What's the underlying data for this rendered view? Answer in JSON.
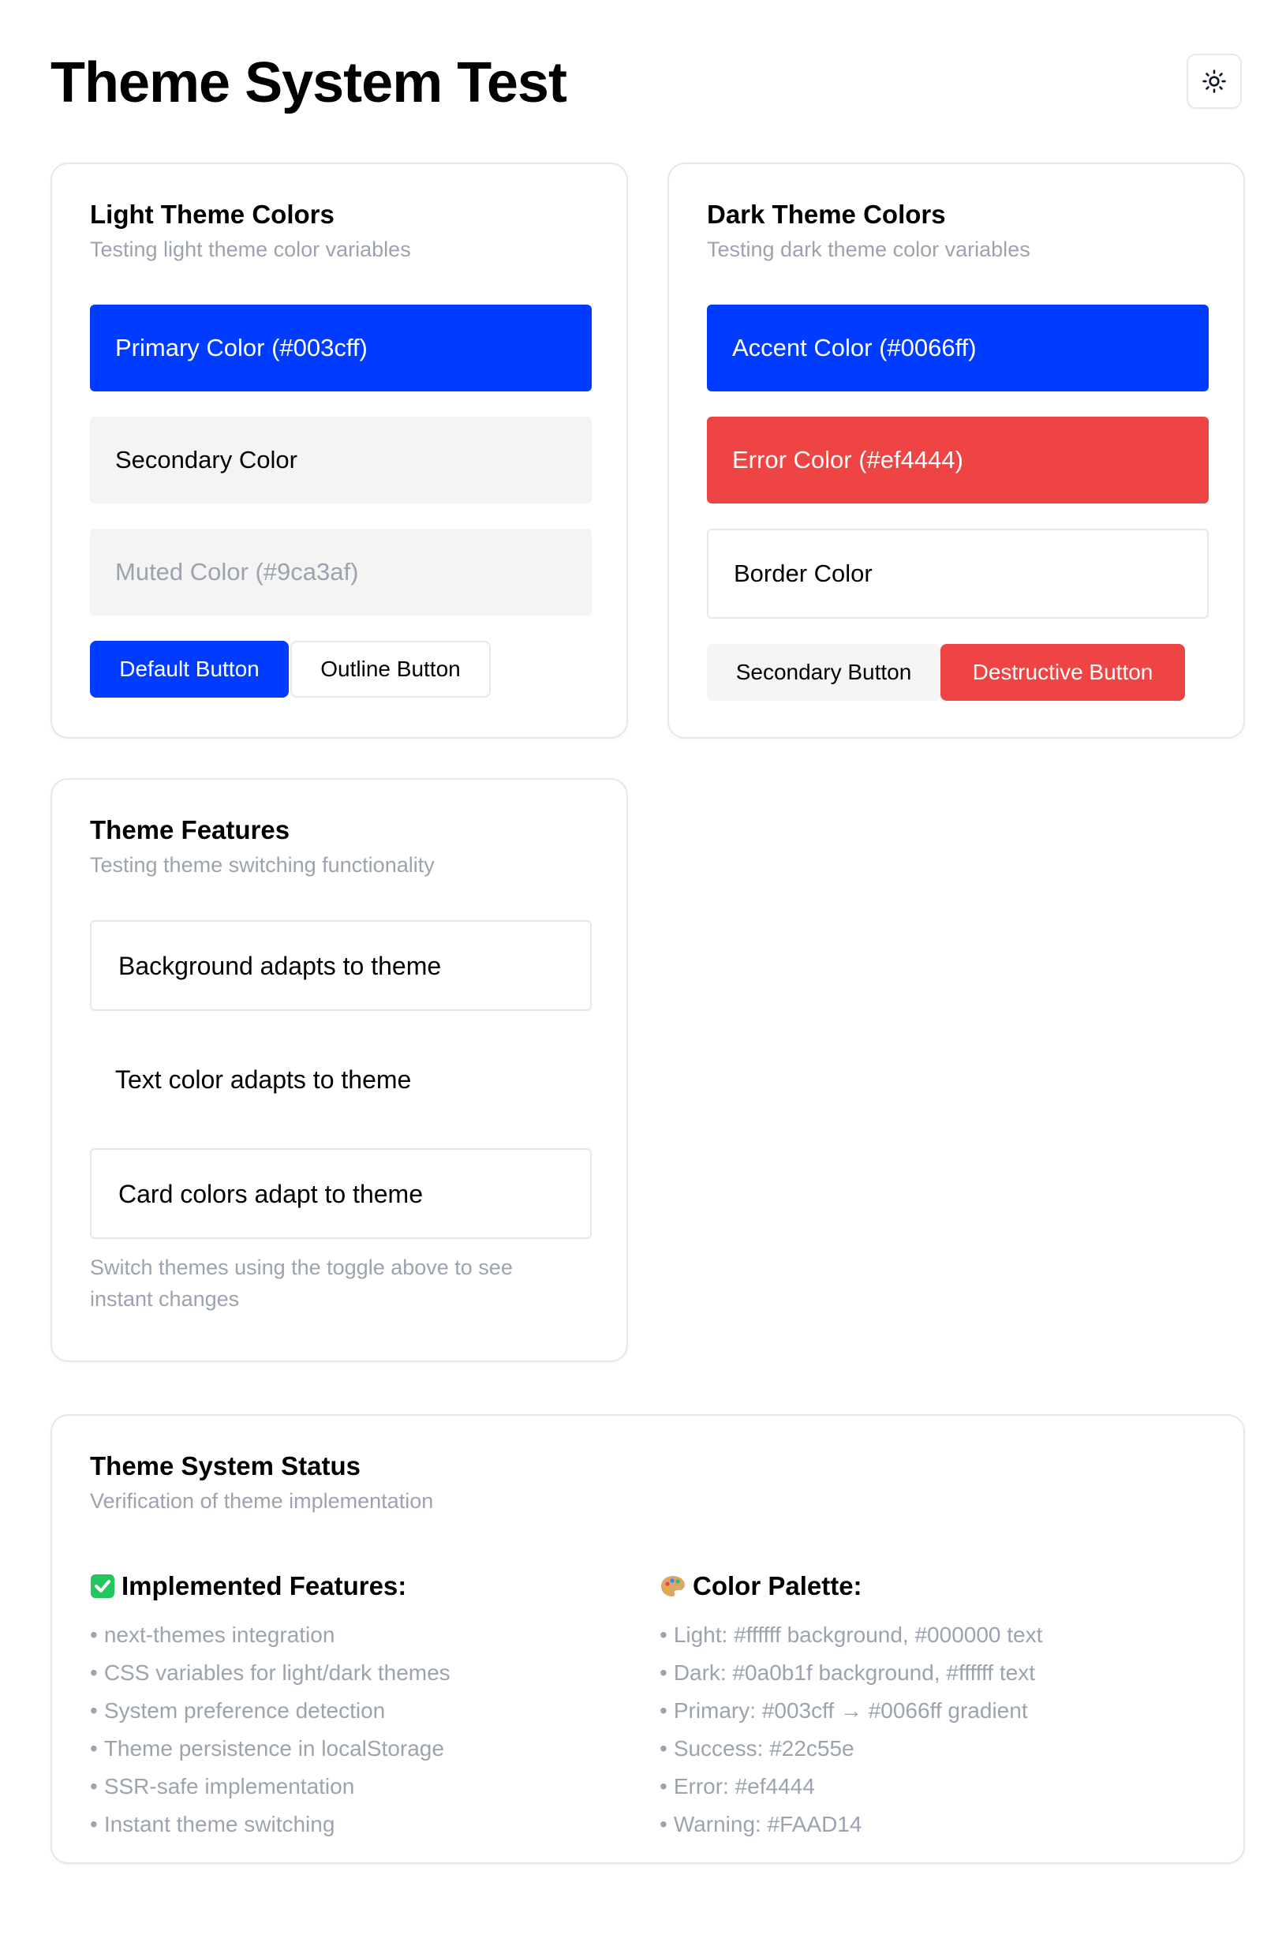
{
  "header": {
    "title": "Theme System Test",
    "toggle_icon": "sun-icon"
  },
  "light_card": {
    "title": "Light Theme Colors",
    "description": "Testing light theme color variables",
    "primary": "Primary Color (#003cff)",
    "secondary": "Secondary Color",
    "muted": "Muted Color (#9ca3af)",
    "default_button": "Default Button",
    "outline_button": "Outline Button"
  },
  "dark_card": {
    "title": "Dark Theme Colors",
    "description": "Testing dark theme color variables",
    "accent": "Accent Color (#0066ff)",
    "error": "Error Color (#ef4444)",
    "border": "Border Color",
    "secondary_button": "Secondary Button",
    "destructive_button": "Destructive Button"
  },
  "features_card": {
    "title": "Theme Features",
    "description": "Testing theme switching functionality",
    "items": [
      "Background adapts to theme",
      "Text color adapts to theme",
      "Card colors adapt to theme"
    ],
    "note": "Switch themes using the toggle above to see instant changes"
  },
  "status_card": {
    "title": "Theme System Status",
    "description": "Verification of theme implementation",
    "implemented": {
      "icon": "check-mark-icon",
      "heading": "Implemented Features:",
      "items": [
        "next-themes integration",
        "CSS variables for light/dark themes",
        "System preference detection",
        "Theme persistence in localStorage",
        "SSR-safe implementation",
        "Instant theme switching"
      ]
    },
    "palette": {
      "icon": "palette-icon",
      "heading": "Color Palette:",
      "items": [
        "Light: #ffffff background, #000000 text",
        "Dark: #0a0b1f background, #ffffff text",
        "Primary: #003cff → #0066ff gradient",
        "Success: #22c55e",
        "Error: #ef4444",
        "Warning: #FAAD14"
      ]
    },
    "bullet": "•"
  },
  "colors": {
    "primary": "#003cff",
    "accent": "#0066ff",
    "error": "#ef4444",
    "muted": "#9ca3af",
    "secondary_bg": "#f4f4f5",
    "border": "#e5e7eb",
    "success": "#22c55e"
  }
}
